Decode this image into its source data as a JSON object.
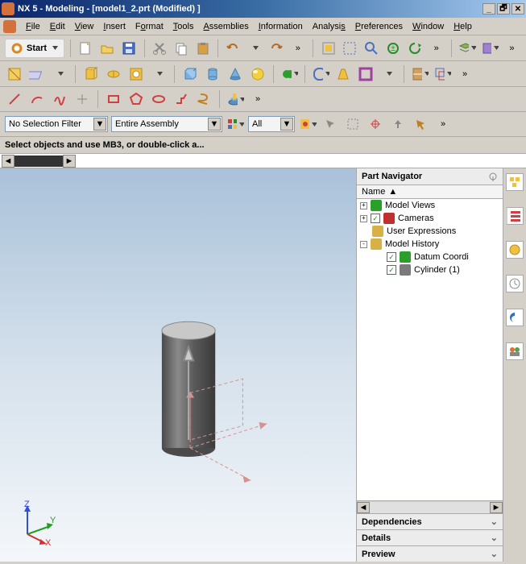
{
  "title": "NX 5 - Modeling - [model1_2.prt (Modified) ]",
  "window_controls": {
    "min": "_",
    "max": "🗗",
    "close": "✕"
  },
  "menu": [
    "File",
    "Edit",
    "View",
    "Insert",
    "Format",
    "Tools",
    "Assemblies",
    "Information",
    "Analysis",
    "Preferences",
    "Window",
    "Help"
  ],
  "menu_hot": [
    "F",
    "E",
    "V",
    "I",
    "F",
    "T",
    "A",
    "I",
    "A",
    "P",
    "W",
    "H"
  ],
  "toolbar1": {
    "start": "Start"
  },
  "selfilters": {
    "filter1": "No Selection Filter",
    "filter2": "Entire Assembly",
    "filter3": "All"
  },
  "hint": "Select objects and use MB3, or double-click a...",
  "navigator": {
    "title": "Part Navigator",
    "col": "Name",
    "tree": [
      {
        "exp": "+",
        "icon": "#2aa02a",
        "label": "Model Views",
        "chk": false,
        "ind": 0
      },
      {
        "exp": "+",
        "icon": "#c03030",
        "label": "Cameras",
        "chk": true,
        "ind": 0
      },
      {
        "exp": "",
        "icon": "#d8b048",
        "label": "User Expressions",
        "chk": false,
        "ind": 0
      },
      {
        "exp": "-",
        "icon": "#d8b048",
        "label": "Model History",
        "chk": false,
        "ind": 0
      },
      {
        "exp": "",
        "icon": "#2aa02a",
        "label": "Datum Coordi",
        "chk": true,
        "ind": 1
      },
      {
        "exp": "",
        "icon": "#7a7a7a",
        "label": "Cylinder (1)",
        "chk": true,
        "ind": 1
      }
    ],
    "footers": [
      "Dependencies",
      "Details",
      "Preview"
    ]
  },
  "triad": {
    "x": "X",
    "y": "Y",
    "z": "Z"
  }
}
